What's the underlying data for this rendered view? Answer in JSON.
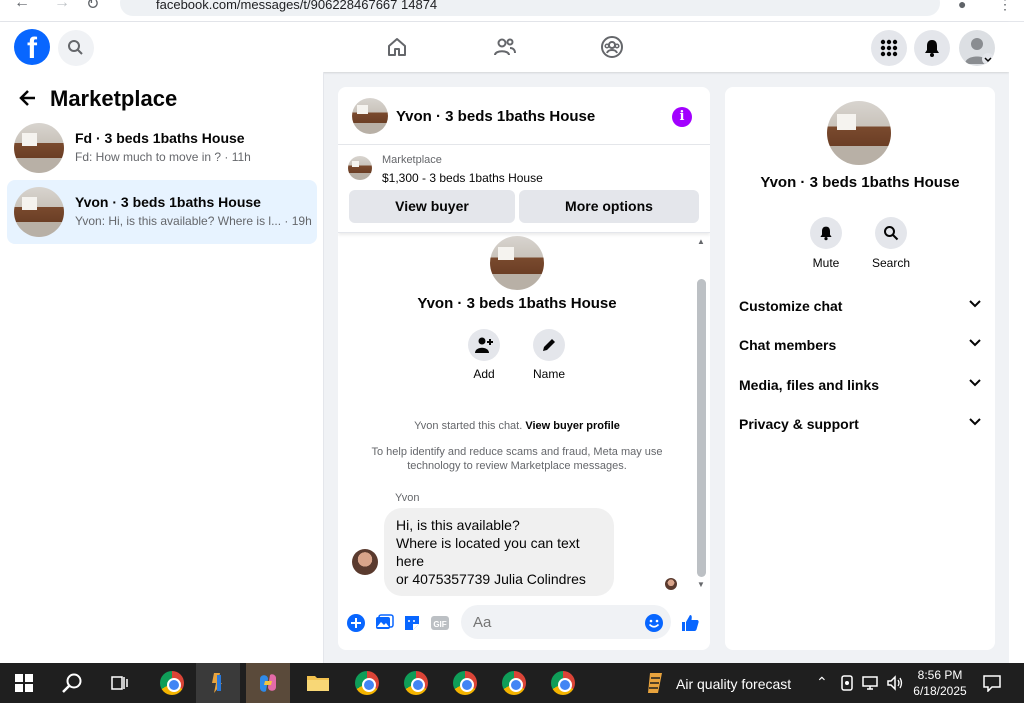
{
  "browser": {
    "url": "facebook.com/messages/t/906228467667 14874"
  },
  "fbnav": {
    "logo": "f",
    "icons": [
      "search-icon",
      "home-icon",
      "friends-icon",
      "groups-icon",
      "menu-grid-icon",
      "bell-icon",
      "profile-avatar"
    ]
  },
  "left": {
    "title": "Marketplace",
    "conversations": [
      {
        "name": "Fd · 3 beds 1baths House",
        "snippet": "Fd: How much to move in ? · 11h"
      },
      {
        "name": "Yvon · 3 beds 1baths House",
        "snippet": "Yvon: Hi, is this available? Where is l... · 19h"
      }
    ]
  },
  "chat": {
    "title": "Yvon · 3 beds 1baths House",
    "info_icon": "i",
    "listing_source": "Marketplace",
    "listing_price": "$1,300 - 3 beds 1baths House",
    "view_buyer": "View buyer",
    "more_options": "More options",
    "center_title": "Yvon · 3 beds 1baths House",
    "add_label": "Add",
    "name_label": "Name",
    "started_text": "Yvon started this chat.",
    "view_profile": "View buyer profile",
    "scam_notice": "To help identify and reduce scams and fraud, Meta may use technology to review Marketplace messages.",
    "sender": "Yvon",
    "message_lines": [
      "Hi, is this available?",
      "Where is located you can text here",
      "or 4075357739 Julia Colindres"
    ],
    "input_placeholder": "Aa"
  },
  "right": {
    "title": "Yvon · 3 beds 1baths House",
    "mute_label": "Mute",
    "search_label": "Search",
    "sections": [
      "Customize chat",
      "Chat members",
      "Media, files and links",
      "Privacy & support"
    ]
  },
  "taskbar": {
    "weather": "Air quality forecast",
    "time": "8:56 PM",
    "date": "6/18/2025"
  }
}
